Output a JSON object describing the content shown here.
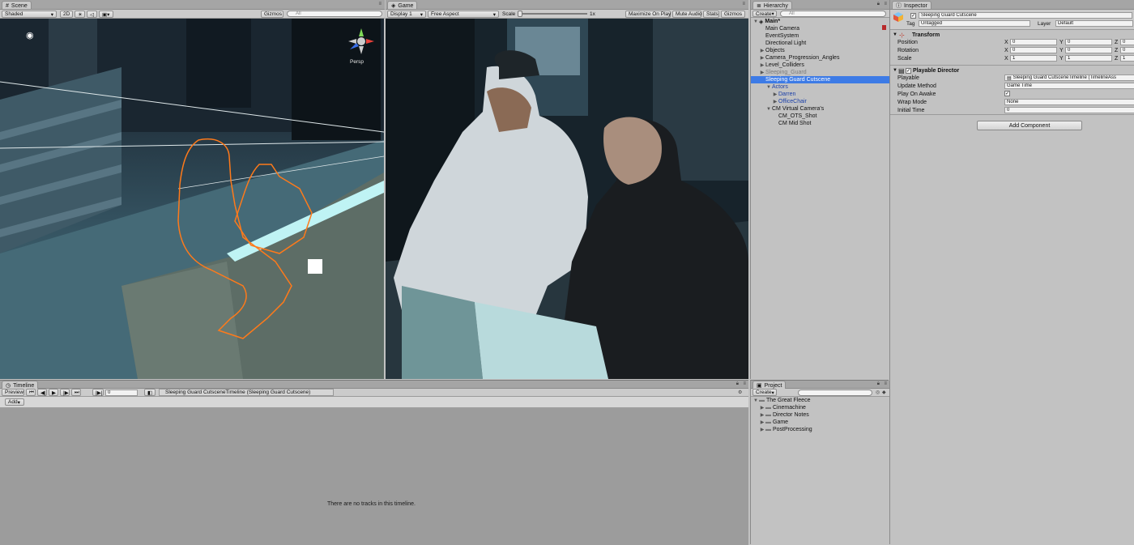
{
  "scene": {
    "tab": "Scene",
    "shading": "Shaded",
    "mode_2d": "2D",
    "gizmos": "Gizmos",
    "search_placeholder": "All",
    "persp": "Persp"
  },
  "game": {
    "tab": "Game",
    "display": "Display 1",
    "aspect": "Free Aspect",
    "scale_label": "Scale",
    "scale_value": "1x",
    "maximize": "Maximize On Play",
    "mute": "Mute Audio",
    "stats": "Stats",
    "gizmos": "Gizmos"
  },
  "hierarchy": {
    "tab": "Hierarchy",
    "create": "Create",
    "search_placeholder": "All",
    "items": [
      {
        "label": "Main*",
        "depth": 0,
        "arrow": "▼",
        "style": "bold"
      },
      {
        "label": "Main Camera",
        "depth": 1,
        "arrow": "",
        "style": "normal"
      },
      {
        "label": "EventSystem",
        "depth": 1,
        "arrow": "",
        "style": "normal"
      },
      {
        "label": "Directional Light",
        "depth": 1,
        "arrow": "",
        "style": "normal"
      },
      {
        "label": "Objects",
        "depth": 1,
        "arrow": "▶",
        "style": "normal"
      },
      {
        "label": "Camera_Progression_Angles",
        "depth": 1,
        "arrow": "▶",
        "style": "normal"
      },
      {
        "label": "Level_Colliders",
        "depth": 1,
        "arrow": "▶",
        "style": "normal"
      },
      {
        "label": "Sleeping_Guard",
        "depth": 1,
        "arrow": "▶",
        "style": "disabled"
      },
      {
        "label": "Sleeping Guard Cutscene",
        "depth": 1,
        "arrow": "",
        "style": "selected"
      },
      {
        "label": "Actors",
        "depth": 2,
        "arrow": "▼",
        "style": "prefab"
      },
      {
        "label": "Darren",
        "depth": 3,
        "arrow": "▶",
        "style": "prefab"
      },
      {
        "label": "OfficeChair",
        "depth": 3,
        "arrow": "▶",
        "style": "prefab"
      },
      {
        "label": "CM Virtual Camera's",
        "depth": 2,
        "arrow": "▼",
        "style": "normal"
      },
      {
        "label": "CM_OTS_Shot",
        "depth": 3,
        "arrow": "",
        "style": "normal"
      },
      {
        "label": "CM Mid Shot",
        "depth": 3,
        "arrow": "",
        "style": "normal"
      }
    ]
  },
  "inspector": {
    "tab": "Inspector",
    "object_name": "Sleeping Guard Cutscene",
    "tag_label": "Tag",
    "tag_value": "Untagged",
    "layer_label": "Layer",
    "layer_value": "Default",
    "transform": {
      "title": "Transform",
      "rows": [
        {
          "label": "Position",
          "x": "0",
          "y": "0",
          "z": "0"
        },
        {
          "label": "Rotation",
          "x": "0",
          "y": "0",
          "z": "0"
        },
        {
          "label": "Scale",
          "x": "1",
          "y": "1",
          "z": "1"
        }
      ],
      "axis_x": "X",
      "axis_y": "Y",
      "axis_z": "Z"
    },
    "director": {
      "title": "Playable Director",
      "playable_label": "Playable",
      "playable_value": "Sleeping Guard CutsceneTimeline (TimelineAss",
      "update_label": "Update Method",
      "update_value": "Game Time",
      "awake_label": "Play On Awake",
      "wrap_label": "Wrap Mode",
      "wrap_value": "None",
      "initial_label": "Initial Time",
      "initial_value": "0"
    },
    "add_component": "Add Component"
  },
  "timeline": {
    "tab": "Timeline",
    "preview": "Preview",
    "frame": "0",
    "breadcrumb": "Sleeping Guard CutsceneTimeline (Sleeping Guard Cutscene)",
    "add": "Add",
    "empty": "There are no tracks in this timeline."
  },
  "project": {
    "tab": "Project",
    "create": "Create",
    "items": [
      {
        "label": "The Great Fleece",
        "depth": 0,
        "arrow": "▼"
      },
      {
        "label": "Cinemachine",
        "depth": 1,
        "arrow": "▶"
      },
      {
        "label": "Director Notes",
        "depth": 1,
        "arrow": "▶"
      },
      {
        "label": "Game",
        "depth": 1,
        "arrow": "▶"
      },
      {
        "label": "PostProcessing",
        "depth": 1,
        "arrow": "▶"
      }
    ]
  },
  "colors": {
    "selection": "#3d7be6",
    "outline": "#ff7a1a",
    "prefab": "#1a3fa8"
  }
}
